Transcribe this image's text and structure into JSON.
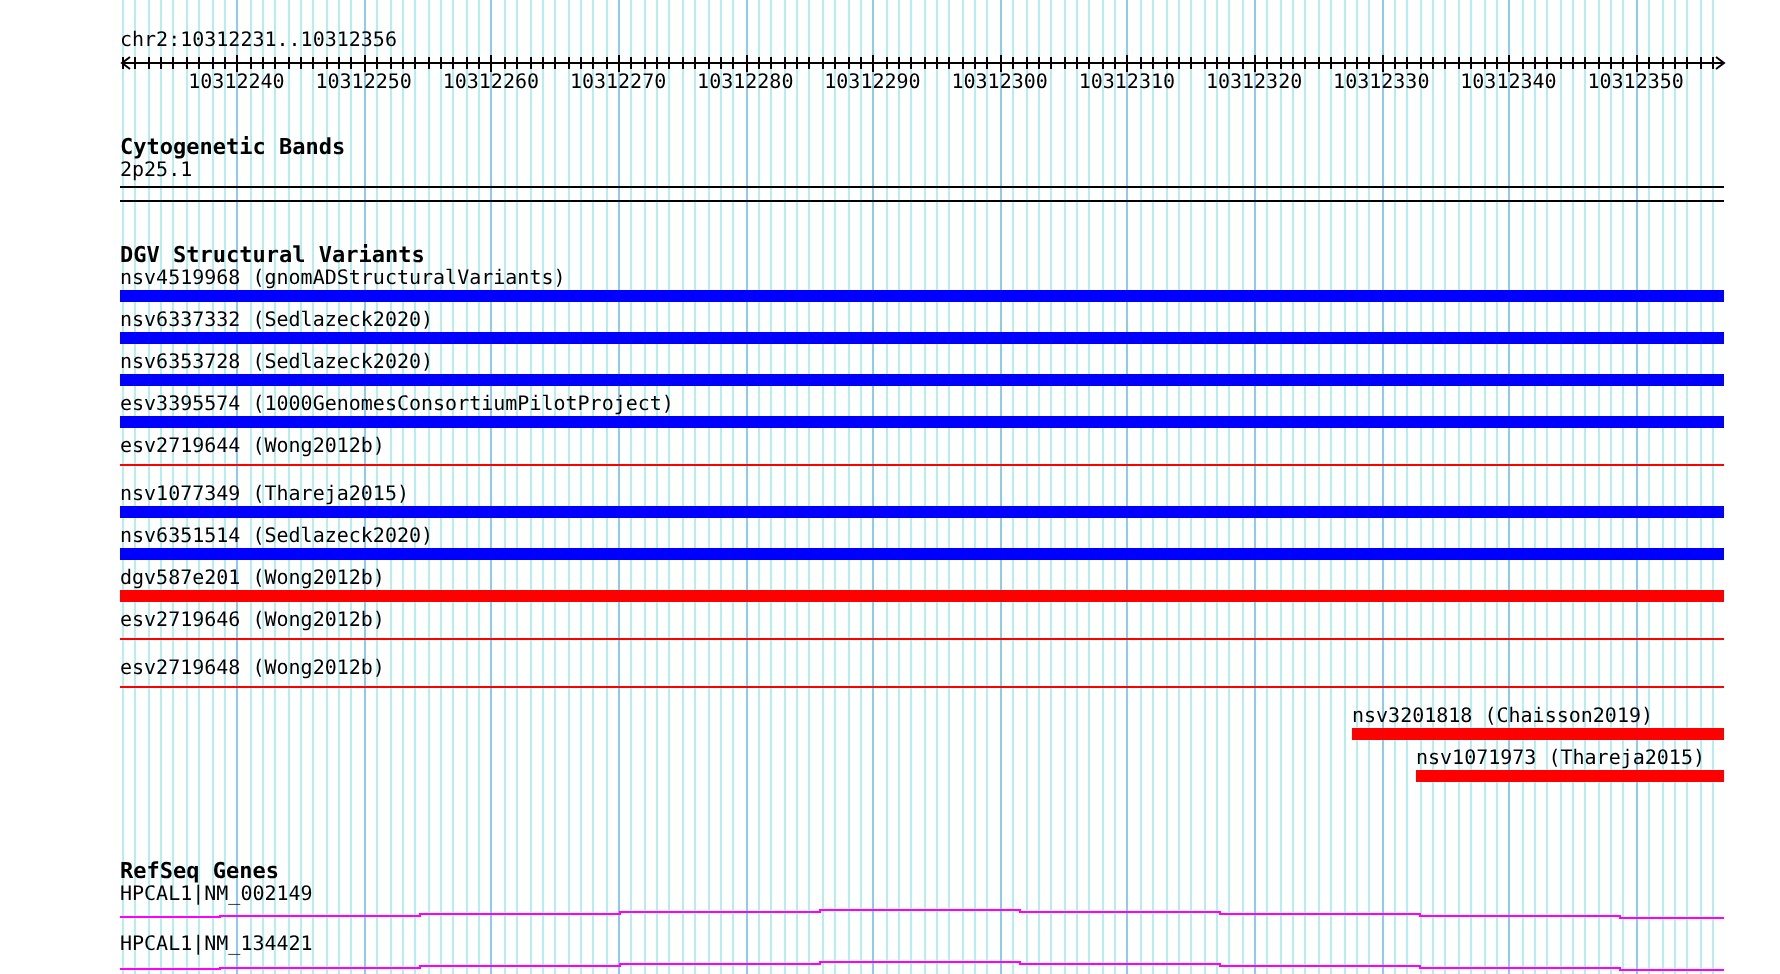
{
  "location": "chr2:10312231..10312356",
  "ruler": {
    "labels": [
      "10312240",
      "10312250",
      "10312260",
      "10312270",
      "10312280",
      "10312290",
      "10312300",
      "10312310",
      "10312320",
      "10312330",
      "10312340",
      "10312350"
    ]
  },
  "tracks": [
    {
      "title": "Cytogenetic Bands",
      "kind": "bands",
      "features": [
        {
          "label": "2p25.1"
        }
      ]
    },
    {
      "title": "DGV Structural Variants",
      "kind": "variants",
      "features": [
        {
          "label": "nsv4519968 (gnomADStructuralVariants)",
          "kind": "bar",
          "color": "#0000ff"
        },
        {
          "label": "nsv6337332 (Sedlazeck2020)",
          "kind": "bar",
          "color": "#0000ff"
        },
        {
          "label": "nsv6353728 (Sedlazeck2020)",
          "kind": "bar",
          "color": "#0000ff"
        },
        {
          "label": "esv3395574 (1000GenomesConsortiumPilotProject)",
          "kind": "bar",
          "color": "#0000ff"
        },
        {
          "label": "esv2719644 (Wong2012b)",
          "kind": "line",
          "color": "#ff0000"
        },
        {
          "label": "nsv1077349 (Thareja2015)",
          "kind": "bar",
          "color": "#0000ff"
        },
        {
          "label": "nsv6351514 (Sedlazeck2020)",
          "kind": "bar",
          "color": "#0000ff"
        },
        {
          "label": "dgv587e201 (Wong2012b)",
          "kind": "bar",
          "color": "#ff0000"
        },
        {
          "label": "esv2719646 (Wong2012b)",
          "kind": "line",
          "color": "#ff0000"
        },
        {
          "label": "esv2719648 (Wong2012b)",
          "kind": "line",
          "color": "#ff0000"
        },
        {
          "label": "nsv3201818 (Chaisson2019)",
          "kind": "bar",
          "color": "#ff0000"
        },
        {
          "label": "nsv1071973 (Thareja2015)",
          "kind": "bar",
          "color": "#ff0000"
        }
      ]
    },
    {
      "title": "RefSeq Genes",
      "kind": "genes",
      "features": [
        {
          "label": "HPCAL1|NM_002149"
        },
        {
          "label": "HPCAL1|NM_134421"
        }
      ]
    }
  ]
}
